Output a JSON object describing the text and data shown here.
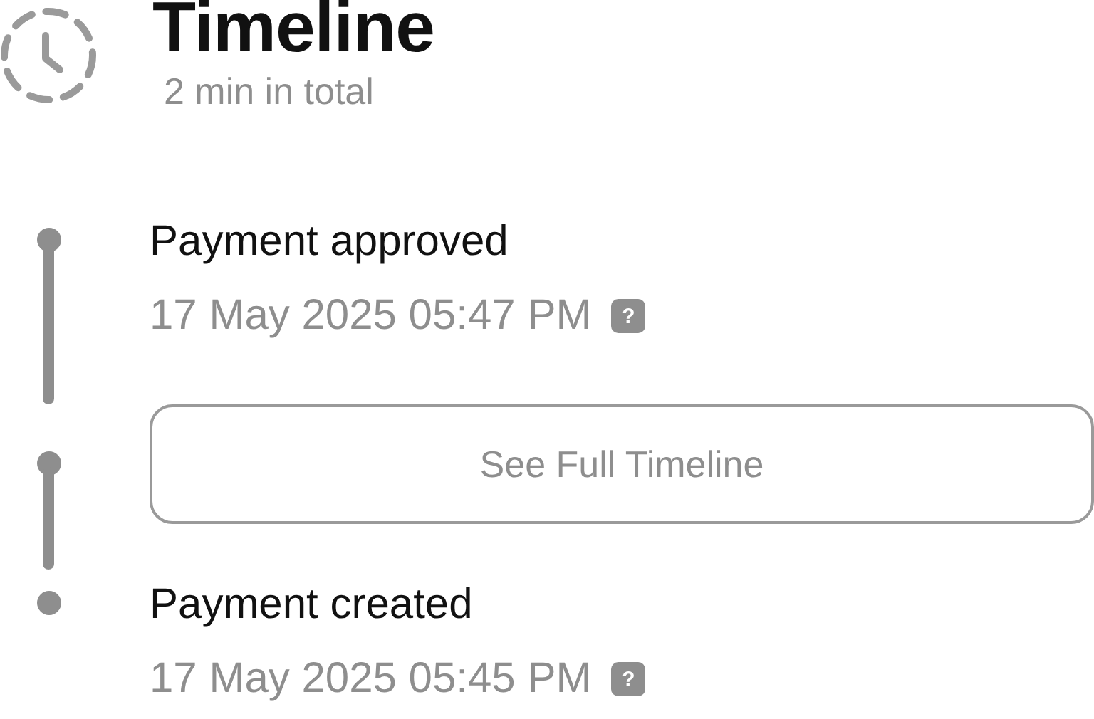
{
  "header": {
    "title": "Timeline",
    "subtitle": "2 min in total"
  },
  "items": [
    {
      "kind": "event",
      "title": "Payment approved",
      "time": "17 May 2025 05:47 PM",
      "help": "?"
    },
    {
      "kind": "button",
      "label": "See Full Timeline"
    },
    {
      "kind": "event",
      "title": "Payment created",
      "time": "17 May 2025 05:45 PM",
      "help": "?"
    }
  ]
}
